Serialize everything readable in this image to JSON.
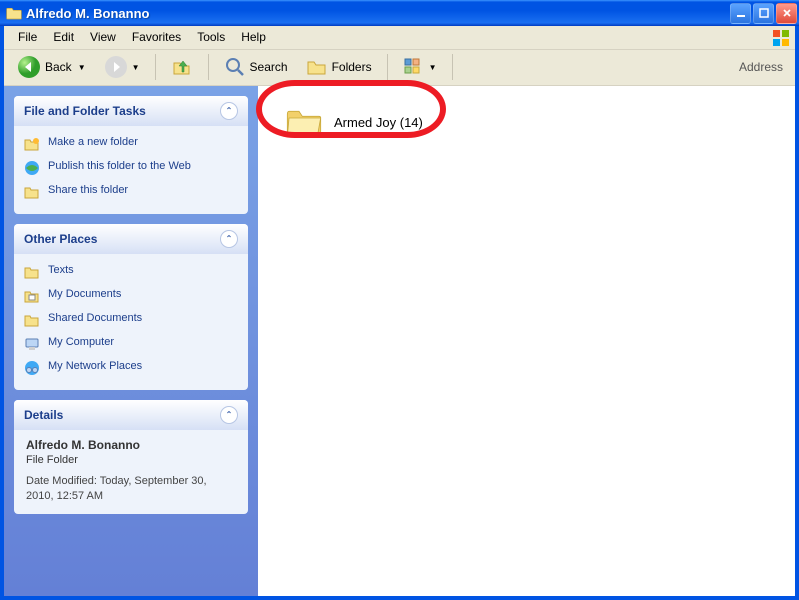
{
  "window": {
    "title": "Alfredo M. Bonanno"
  },
  "menu": {
    "file": "File",
    "edit": "Edit",
    "view": "View",
    "favorites": "Favorites",
    "tools": "Tools",
    "help": "Help"
  },
  "toolbar": {
    "back": "Back",
    "search": "Search",
    "folders": "Folders",
    "address_label": "Address"
  },
  "sidebar": {
    "tasks_title": "File and Folder Tasks",
    "tasks": [
      {
        "label": "Make a new folder"
      },
      {
        "label": "Publish this folder to the Web"
      },
      {
        "label": "Share this folder"
      }
    ],
    "places_title": "Other Places",
    "places": [
      {
        "label": "Texts"
      },
      {
        "label": "My Documents"
      },
      {
        "label": "Shared Documents"
      },
      {
        "label": "My Computer"
      },
      {
        "label": "My Network Places"
      }
    ],
    "details_title": "Details",
    "details": {
      "name": "Alfredo M. Bonanno",
      "type": "File Folder",
      "modified": "Date Modified: Today, September 30, 2010, 12:57 AM"
    }
  },
  "content": {
    "folder_name": "Armed Joy (14)"
  },
  "annotation": {
    "red_circle_around": "content.folder_name"
  }
}
